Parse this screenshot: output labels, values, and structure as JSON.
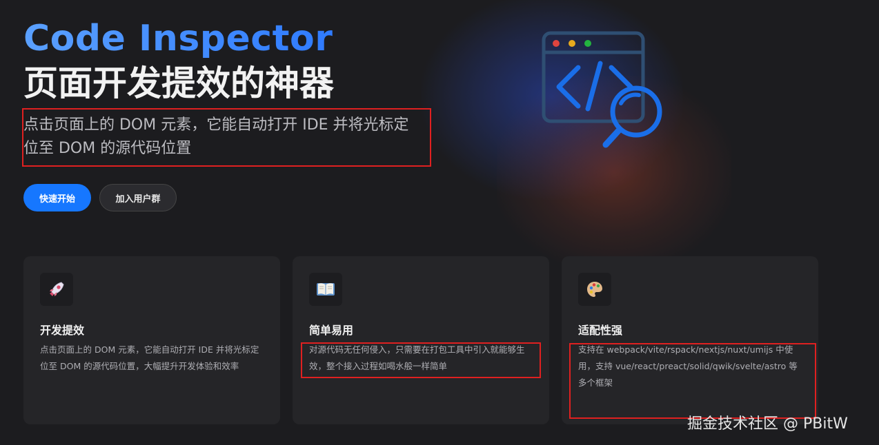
{
  "hero": {
    "title": "Code Inspector",
    "subtitle": "页面开发提效的神器",
    "description": "点击页面上的 DOM 元素，它能自动打开 IDE 并将光标定位至 DOM 的源代码位置"
  },
  "buttons": {
    "primary": "快速开始",
    "secondary": "加入用户群"
  },
  "features": [
    {
      "icon": "rocket-icon",
      "title": "开发提效",
      "text": "点击页面上的 DOM 元素，它能自动打开 IDE 并将光标定位至 DOM 的源代码位置，大幅提升开发体验和效率"
    },
    {
      "icon": "open-book-icon",
      "title": "简单易用",
      "text": "对源代码无任何侵入，只需要在打包工具中引入就能够生效，整个接入过程如喝水般一样简单"
    },
    {
      "icon": "palette-icon",
      "title": "适配性强",
      "text": "支持在 webpack/vite/rspack/nextjs/nuxt/umijs 中使用，支持 vue/react/preact/solid/qwik/svelte/astro 等多个框架"
    }
  ],
  "watermark": "掘金技术社区 @ PBitW",
  "colors": {
    "accent": "#1677ff",
    "title_gradient_start": "#5aa0ff",
    "highlight_box": "#e02020",
    "background": "#1c1c1f",
    "card": "#252528"
  }
}
